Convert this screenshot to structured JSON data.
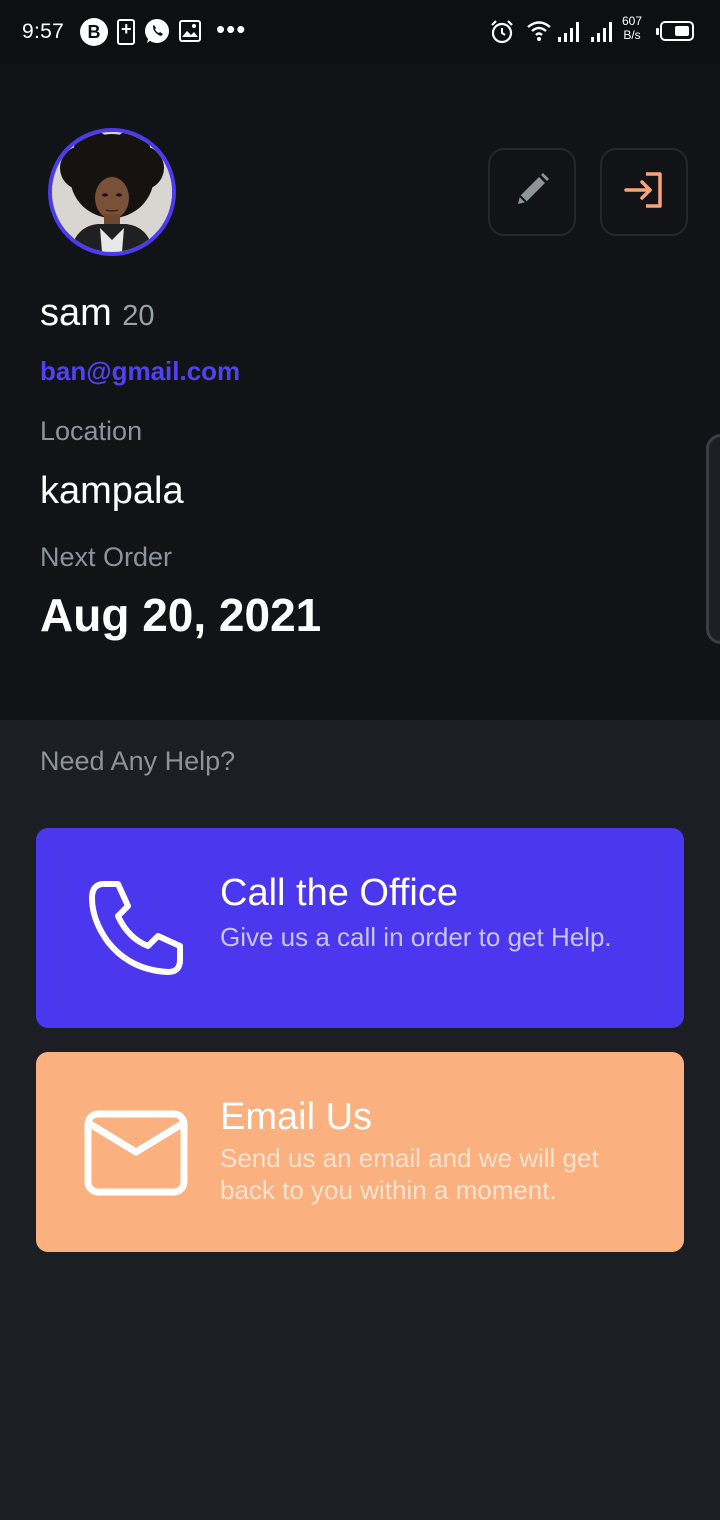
{
  "status_bar": {
    "time": "9:57",
    "b_icon": "B",
    "dots": "•••",
    "speed_value": "607",
    "speed_unit": "B/s"
  },
  "profile": {
    "name": "sam",
    "age": "20",
    "email": "ban@gmail.com",
    "location_label": "Location",
    "location_value": "kampala",
    "next_order_label": "Next Order",
    "next_order_value": "Aug 20, 2021",
    "edit_icon": "pencil-icon",
    "logout_icon": "logout-icon"
  },
  "help": {
    "title": "Need Any Help?",
    "call": {
      "title": "Call the Office",
      "subtitle": "Give us a call in order to get Help.",
      "icon": "phone-icon",
      "color": "#4b37ee"
    },
    "email": {
      "title": "Email Us",
      "subtitle": "Send us an email and we will get back to you within a moment.",
      "icon": "envelope-icon",
      "color": "#fbb07f"
    }
  },
  "colors": {
    "accent": "#4b3aef",
    "logout_accent": "#f8a47a",
    "background": "#1b1e22",
    "panel": "#111316"
  }
}
